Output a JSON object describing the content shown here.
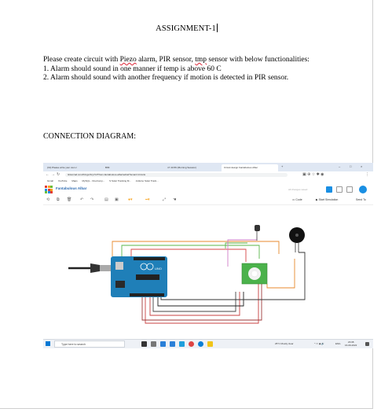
{
  "document": {
    "title": "ASSIGNMENT-1",
    "task_prefix": "Please create circuit with ",
    "task_piezo": "Piezo",
    "task_mid": " alarm, PIR sensor, ",
    "task_tmp": "tmp",
    "task_suffix": " sensor with below functionalities:",
    "item_1": "1. Alarm should sound in one manner if temp is above 60 C",
    "item_2": "2. Alarm should sound with another frequency if motion is detected in PIR sensor.",
    "heading": "CONNECTION DIAGRAM:"
  },
  "screenshot": {
    "tabs": [
      {
        "label": "(19) Please write your own c"
      },
      {
        "label": "BIM"
      },
      {
        "label": "n7 43-56 (Morning Session)"
      },
      {
        "label": "Circuit design Fantabulous Alber"
      }
    ],
    "url": "tinkercad.com/things/3cy7c2TKam-fantabulous-albar/editel?tenant=circuits",
    "bookmarks": [
      "Gmail",
      "YouTube",
      "Maps",
      "MySQL - OneComp...",
      "S Solar Tracking M...",
      "Arduino Solar Track..."
    ],
    "project_name": "Fantabulous Albar",
    "saved_status": "All changes saved",
    "code_label": "Code",
    "simulate_label": "Start Simulation",
    "send_label": "Send To",
    "search_placeholder": "Type here to search",
    "weather": "25°C Mostly clear",
    "lang": "ENG",
    "time": "23:08",
    "date": "16-09-2022",
    "board_text": "UNO",
    "accent": "#1a8fe3"
  }
}
